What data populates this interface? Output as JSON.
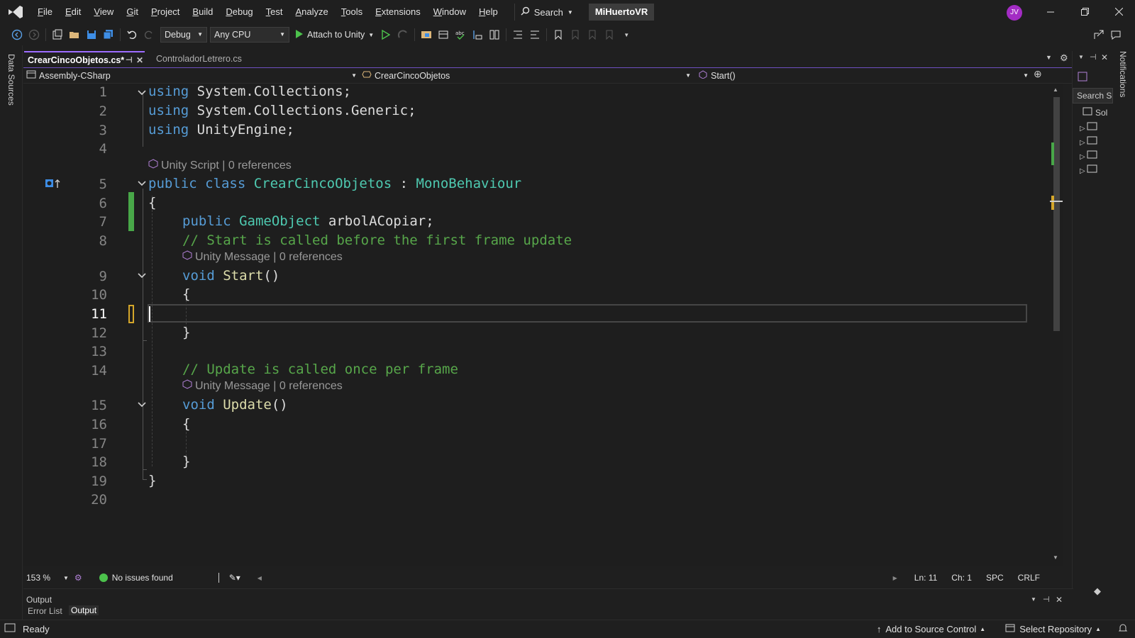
{
  "menu": {
    "items": [
      "File",
      "Edit",
      "View",
      "Git",
      "Project",
      "Build",
      "Debug",
      "Test",
      "Analyze",
      "Tools",
      "Extensions",
      "Window",
      "Help"
    ],
    "search_label": "Search",
    "solution_name": "MiHuertoVR",
    "avatar_initials": "JV"
  },
  "toolbar": {
    "configuration": "Debug",
    "platform": "Any CPU",
    "attach_label": "Attach to Unity"
  },
  "left_strip": {
    "data_sources": "Data Sources"
  },
  "right_strip": {
    "notifications": "Notifications",
    "search_placeholder": "Search S",
    "solution_label": "Sol"
  },
  "tabs": [
    {
      "label": "CrearCincoObjetos.cs*",
      "active": true
    },
    {
      "label": "ControladorLetrero.cs",
      "active": false
    }
  ],
  "navbar": {
    "project": "Assembly-CSharp",
    "type": "CrearCincoObjetos",
    "member": "Start()"
  },
  "editor": {
    "line_numbers": [
      "1",
      "2",
      "3",
      "4",
      "5",
      "6",
      "7",
      "8",
      "9",
      "10",
      "11",
      "12",
      "13",
      "14",
      "15",
      "16",
      "17",
      "18",
      "19",
      "20"
    ],
    "current_line": "11",
    "lines": {
      "l1": [
        "using",
        " System",
        ".",
        "Collections",
        ";"
      ],
      "l2": [
        "using",
        " System",
        ".",
        "Collections",
        ".",
        "Generic",
        ";"
      ],
      "l3": [
        "using",
        " UnityEngine",
        ";"
      ],
      "l5": [
        "public",
        " class",
        " CrearCincoObjetos",
        " : ",
        "MonoBehaviour"
      ],
      "l6": "{",
      "l7": [
        "public",
        " GameObject",
        " arbolACopiar;"
      ],
      "l8": "// Start is called before the first frame update",
      "l9": [
        "void",
        " Start",
        "()"
      ],
      "l10": "{",
      "l12": "}",
      "l14": "// Update is called once per frame",
      "l15": [
        "void",
        " Update",
        "()"
      ],
      "l16": "{",
      "l18": "}",
      "l19": "}"
    },
    "codelens": {
      "class": "Unity Script | 0 references",
      "start": "Unity Message | 0 references",
      "update": "Unity Message | 0 references"
    }
  },
  "editor_status": {
    "zoom": "153 %",
    "issues": "No issues found",
    "line": "Ln: 11",
    "char": "Ch: 1",
    "whitespace": "SPC",
    "line_ending": "CRLF"
  },
  "output_panel": {
    "title": "Output",
    "tabs": [
      "Error List",
      "Output"
    ]
  },
  "status": {
    "ready": "Ready",
    "source_control": "Add to Source Control",
    "repository": "Select Repository"
  },
  "colors": {
    "accent": "#9d6cff",
    "keyword": "#569cd6",
    "type": "#4ec9b0",
    "comment": "#57a64a",
    "method": "#dcdcaa"
  }
}
